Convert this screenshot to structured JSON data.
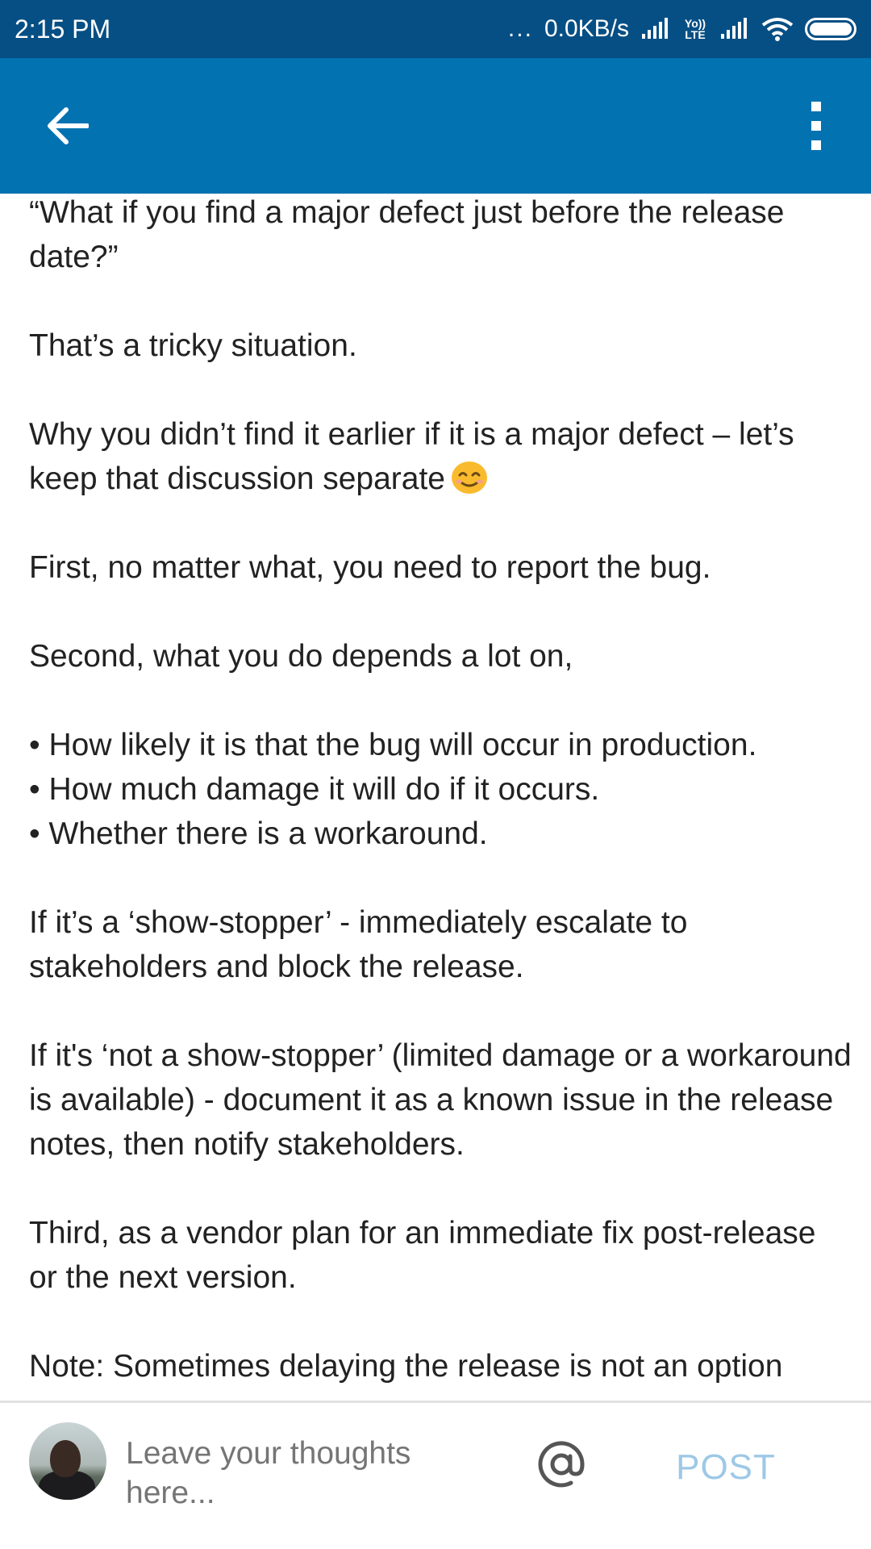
{
  "status_bar": {
    "time": "2:15 PM",
    "dots": "...",
    "network_speed": "0.0KB/s",
    "volte_top": "Yo))",
    "volte_bottom": "LTE"
  },
  "app_bar": {
    "back_icon": "arrow-left-icon",
    "more_icon": "more-vertical-icon"
  },
  "article": {
    "paragraphs": [
      "“What if you find a major defect just before the release date?”",
      "That’s a tricky situation.",
      "Why you didn’t find it earlier if it is a major defect – let’s keep that discussion separate",
      "First, no matter what, you need to report the bug.",
      "Second, what you do depends a lot on,"
    ],
    "bullets": [
      "How likely it is that the bug will occur in production.",
      "How much damage it will do if it occurs.",
      "Whether there is a workaround."
    ],
    "paragraphs_after": [
      "If it’s a ‘show-stopper’ - immediately escalate to stakeholders and block the release.",
      "If it's ‘not a show-stopper’ (limited damage or a workaround is available) - document it as a known issue in the release notes, then notify stakeholders.",
      "Third, as a vendor plan for an immediate fix post-release or the next version.",
      "Note: Sometimes delaying the release is not an option"
    ],
    "emoji_icon": "smiling-face-icon"
  },
  "composer": {
    "placeholder": "Leave your thoughts here...",
    "mention_icon": "at-sign-icon",
    "post_label": "POST"
  },
  "colors": {
    "status_bar": "#064f84",
    "app_bar": "#0272b1",
    "post_disabled": "#9ec8e6"
  }
}
